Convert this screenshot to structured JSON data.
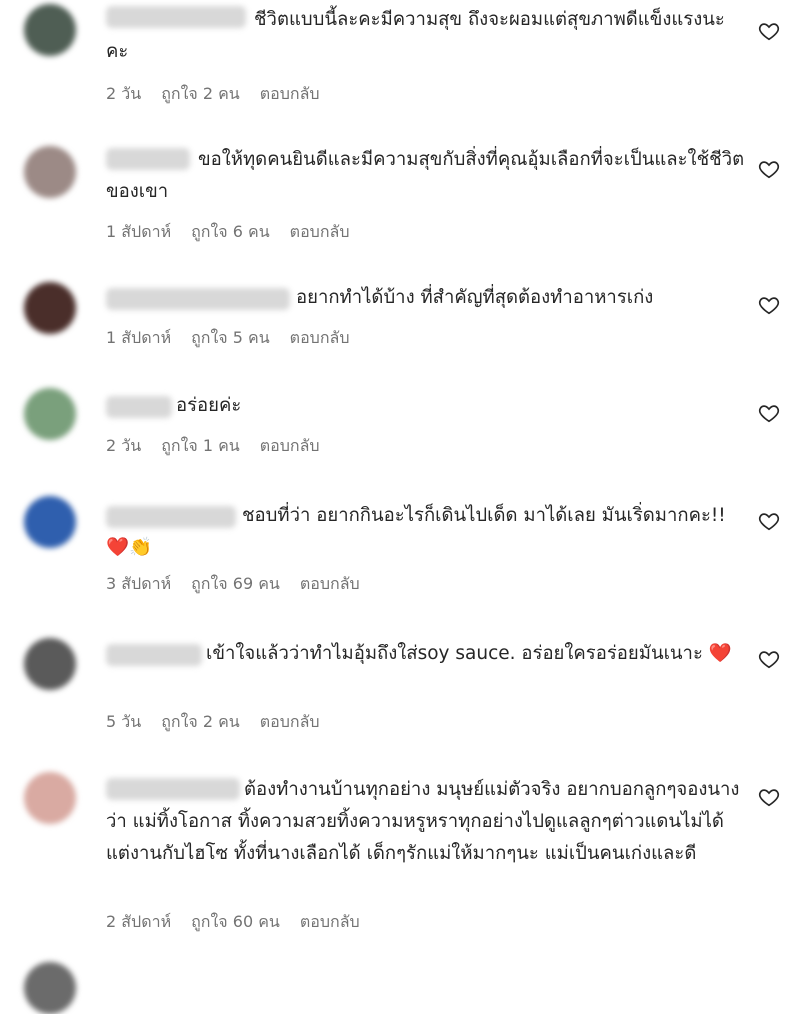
{
  "comments": [
    {
      "text": "ชีวิตแบบนี้ละคะมีความสุข ถึงจะผอมแต่สุขภาพดีแข็งแรงนะคะ",
      "time": "2 วัน",
      "likes": "ถูกใจ 2 คน",
      "reply": "ตอบกลับ",
      "avatar_color": "#4f5e54"
    },
    {
      "text": "ขอให้ทุดคนยินดีและมีความสุขกับสิ่งที่คุณอุ้มเลือกที่จะเป็นและใช้ชีวิต ของเขา",
      "time": "1 สัปดาห์",
      "likes": "ถูกใจ 6 คน",
      "reply": "ตอบกลับ",
      "avatar_color": "#9c8a86"
    },
    {
      "text": "อยากทำได้บ้าง ที่สำคัญที่สุดต้องทำอาหารเก่ง",
      "time": "1 สัปดาห์",
      "likes": "ถูกใจ 5 คน",
      "reply": "ตอบกลับ",
      "avatar_color": "#4a2e2a"
    },
    {
      "text": "อร่อยค่ะ",
      "time": "2 วัน",
      "likes": "ถูกใจ 1 คน",
      "reply": "ตอบกลับ",
      "avatar_color": "#7aa07c"
    },
    {
      "text": "ชอบที่ว่า อยากกินอะไรก็เดินไปเด็ด มาได้เลย มันเริ่ดมากคะ!! ❤️👏",
      "time": "3 สัปดาห์",
      "likes": "ถูกใจ 69 คน",
      "reply": "ตอบกลับ",
      "avatar_color": "#2f5fae"
    },
    {
      "text": "เข้าใจแล้วว่าทำไมอุ้มถึงใส่soy sauce. อร่อยใครอร่อยมันเนาะ ❤️",
      "time": "5 วัน",
      "likes": "ถูกใจ 2 คน",
      "reply": "ตอบกลับ",
      "avatar_color": "#5a5a5a"
    },
    {
      "text": "ต้องทำงานบ้านทุกอย่าง มนุษย์แม่ตัวจริง อยากบอกลูกๆจองนางว่า แม่ทิ้งโอกาส ทิ้งความสวยทิ้งความหรูหราทุกอย่างไปดูแลลูกๆต่าวแดนไม่ได้แต่งานกับไฮโซ ทั้งที่นางเลือกได้ เด็กๆรักแม่ให้มากๆนะ แม่เป็นคนเก่งและดี",
      "time": "2 สัปดาห์",
      "likes": "ถูกใจ 60 คน",
      "reply": "ตอบกลับ",
      "avatar_color": "#d9aaa2"
    }
  ]
}
